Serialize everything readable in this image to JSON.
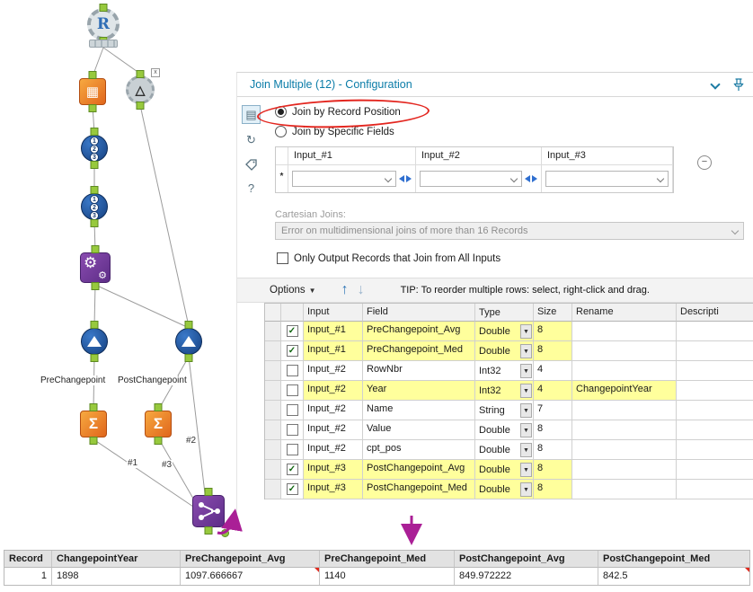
{
  "canvas": {
    "annotations": {
      "pre": "PreChangepoint",
      "post": "PostChangepoint"
    },
    "connections": {
      "c1": "#1",
      "c2": "#2",
      "c3": "#3"
    }
  },
  "config": {
    "title": "Join Multiple (12) - Configuration",
    "join_by_record": "Join by Record Position",
    "join_by_fields": "Join by Specific Fields",
    "input_columns": [
      "Input_#1",
      "Input_#2",
      "Input_#3"
    ],
    "row_marker": "*",
    "cartesian_label": "Cartesian Joins:",
    "cartesian_value": "Error on multidimensional joins of more than 16 Records",
    "only_output_label": "Only Output Records that Join from All Inputs",
    "options_label": "Options",
    "tip": "TIP: To reorder multiple rows: select, right-click and drag.",
    "grid": {
      "headers": {
        "input": "Input",
        "field": "Field",
        "type": "Type",
        "size": "Size",
        "rename": "Rename",
        "description": "Descripti"
      },
      "rows": [
        {
          "check": "✓",
          "input": "Input_#1",
          "field": "PreChangepoint_Avg",
          "type": "Double",
          "size": "8",
          "rename": "",
          "highlight": true
        },
        {
          "check": "✓",
          "input": "Input_#1",
          "field": "PreChangepoint_Med",
          "type": "Double",
          "size": "8",
          "rename": "",
          "highlight": true
        },
        {
          "check": "",
          "input": "Input_#2",
          "field": "RowNbr",
          "type": "Int32",
          "size": "4",
          "rename": "",
          "highlight": false
        },
        {
          "check": "",
          "input": "Input_#2",
          "field": "Year",
          "type": "Int32",
          "size": "4",
          "rename": "ChangepointYear",
          "highlight": true
        },
        {
          "check": "",
          "input": "Input_#2",
          "field": "Name",
          "type": "String",
          "size": "7",
          "rename": "",
          "highlight": false
        },
        {
          "check": "",
          "input": "Input_#2",
          "field": "Value",
          "type": "Double",
          "size": "8",
          "rename": "",
          "highlight": false
        },
        {
          "check": "",
          "input": "Input_#2",
          "field": "cpt_pos",
          "type": "Double",
          "size": "8",
          "rename": "",
          "highlight": false
        },
        {
          "check": "✓",
          "input": "Input_#3",
          "field": "PostChangepoint_Avg",
          "type": "Double",
          "size": "8",
          "rename": "",
          "highlight": true
        },
        {
          "check": "✓",
          "input": "Input_#3",
          "field": "PostChangepoint_Med",
          "type": "Double",
          "size": "8",
          "rename": "",
          "highlight": true
        }
      ]
    }
  },
  "results": {
    "headers": [
      "Record",
      "ChangepointYear",
      "PreChangepoint_Avg",
      "PreChangepoint_Med",
      "PostChangepoint_Avg",
      "PostChangepoint_Med"
    ],
    "row": [
      "1",
      "1898",
      "1097.666667",
      "1140",
      "849.972222",
      "842.5"
    ]
  },
  "colors": {
    "accent_teal": "#0a7ca8",
    "highlight_yellow": "#ffff9c",
    "annotation_magenta": "#aa1f96",
    "annotation_red": "#e3261f"
  }
}
